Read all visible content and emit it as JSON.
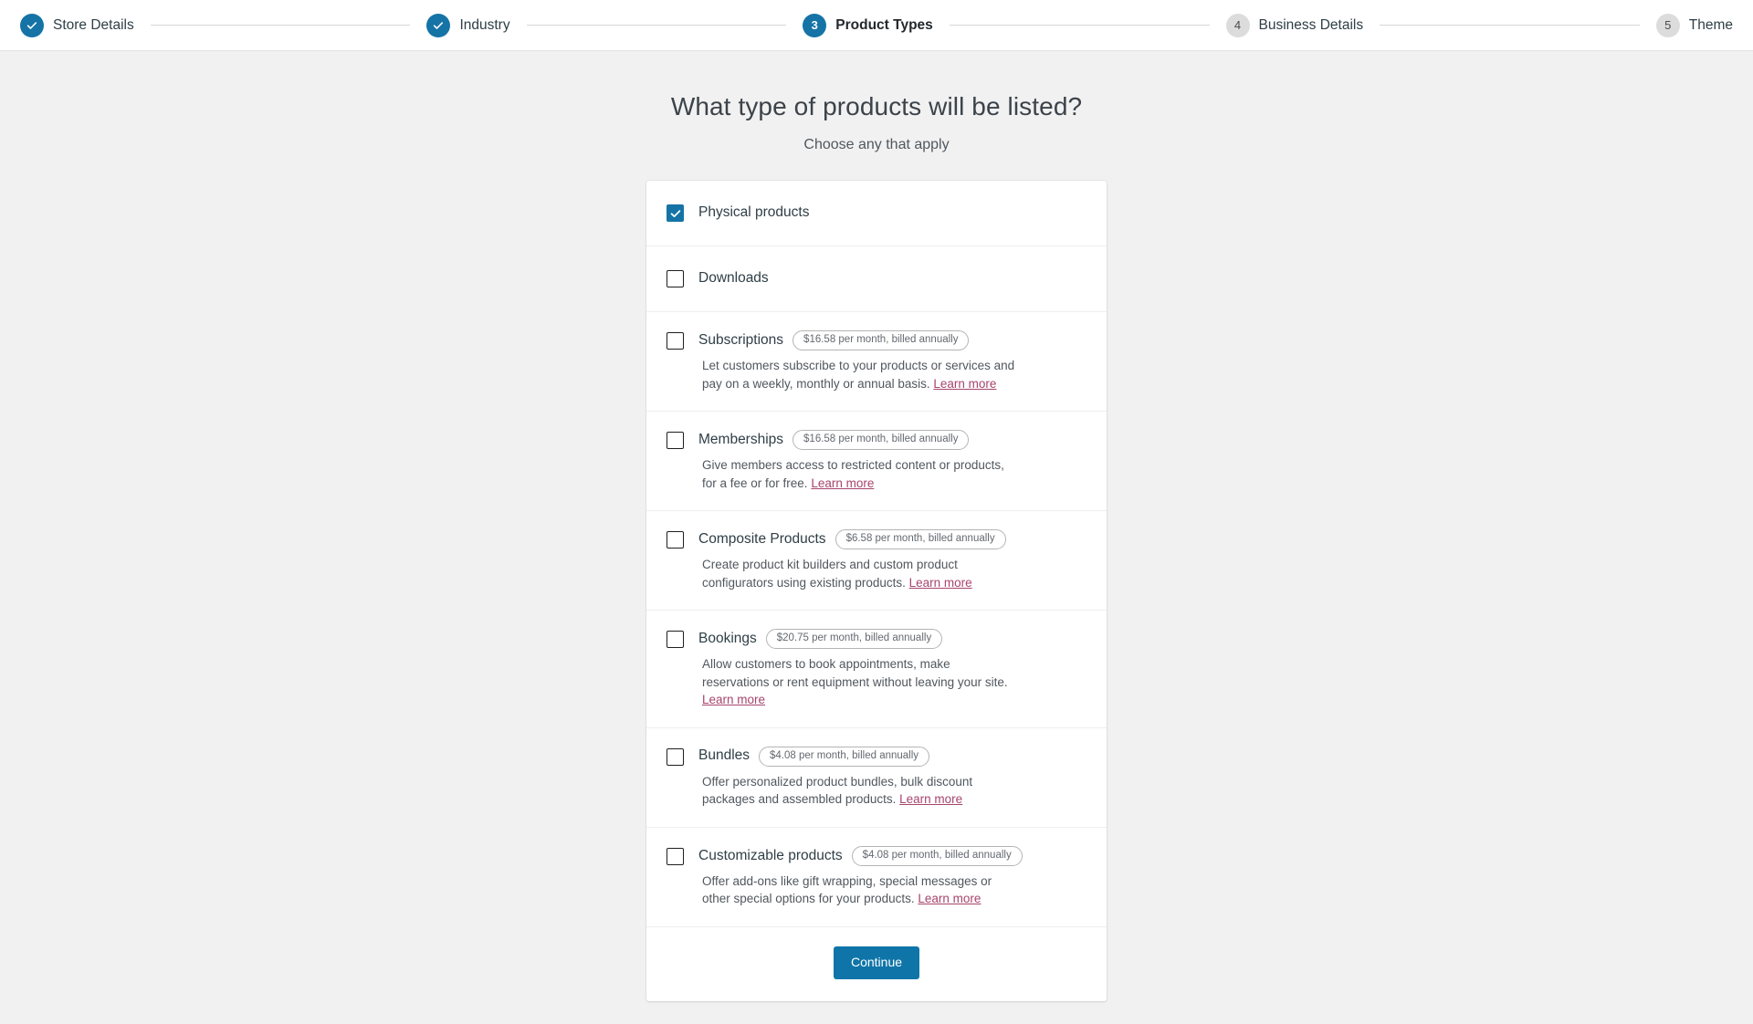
{
  "stepper": {
    "steps": [
      {
        "label": "Store Details",
        "state": "complete",
        "marker": "check-icon"
      },
      {
        "label": "Industry",
        "state": "complete",
        "marker": "check-icon"
      },
      {
        "label": "Product Types",
        "state": "current",
        "marker": "3"
      },
      {
        "label": "Business Details",
        "state": "pending",
        "marker": "4"
      },
      {
        "label": "Theme",
        "state": "pending",
        "marker": "5"
      }
    ]
  },
  "page": {
    "title": "What type of products will be listed?",
    "subtitle": "Choose any that apply"
  },
  "options": [
    {
      "title": "Physical products",
      "checked": true,
      "price": "",
      "description": "",
      "learn_more": ""
    },
    {
      "title": "Downloads",
      "checked": false,
      "price": "",
      "description": "",
      "learn_more": ""
    },
    {
      "title": "Subscriptions",
      "checked": false,
      "price": "$16.58 per month, billed annually",
      "description": "Let customers subscribe to your products or services and pay on a weekly, monthly or annual basis. ",
      "learn_more": "Learn more"
    },
    {
      "title": "Memberships",
      "checked": false,
      "price": "$16.58 per month, billed annually",
      "description": "Give members access to restricted content or products, for a fee or for free. ",
      "learn_more": "Learn more"
    },
    {
      "title": "Composite Products",
      "checked": false,
      "price": "$6.58 per month, billed annually",
      "description": "Create product kit builders and custom product configurators using existing products. ",
      "learn_more": "Learn more"
    },
    {
      "title": "Bookings",
      "checked": false,
      "price": "$20.75 per month, billed annually",
      "description": "Allow customers to book appointments, make reservations or rent equipment without leaving your site. ",
      "learn_more": "Learn more"
    },
    {
      "title": "Bundles",
      "checked": false,
      "price": "$4.08 per month, billed annually",
      "description": "Offer personalized product bundles, bulk discount packages and assembled products. ",
      "learn_more": "Learn more"
    },
    {
      "title": "Customizable products",
      "checked": false,
      "price": "$4.08 per month, billed annually",
      "description": "Offer add-ons like gift wrapping, special messages or other special options for your products. ",
      "learn_more": "Learn more"
    }
  ],
  "footer": {
    "continue_label": "Continue"
  },
  "colors": {
    "accent_blue": "#1573a6",
    "button_blue": "#0f75a8",
    "link_purple": "#a7446d",
    "page_background": "#f1f1f1"
  }
}
